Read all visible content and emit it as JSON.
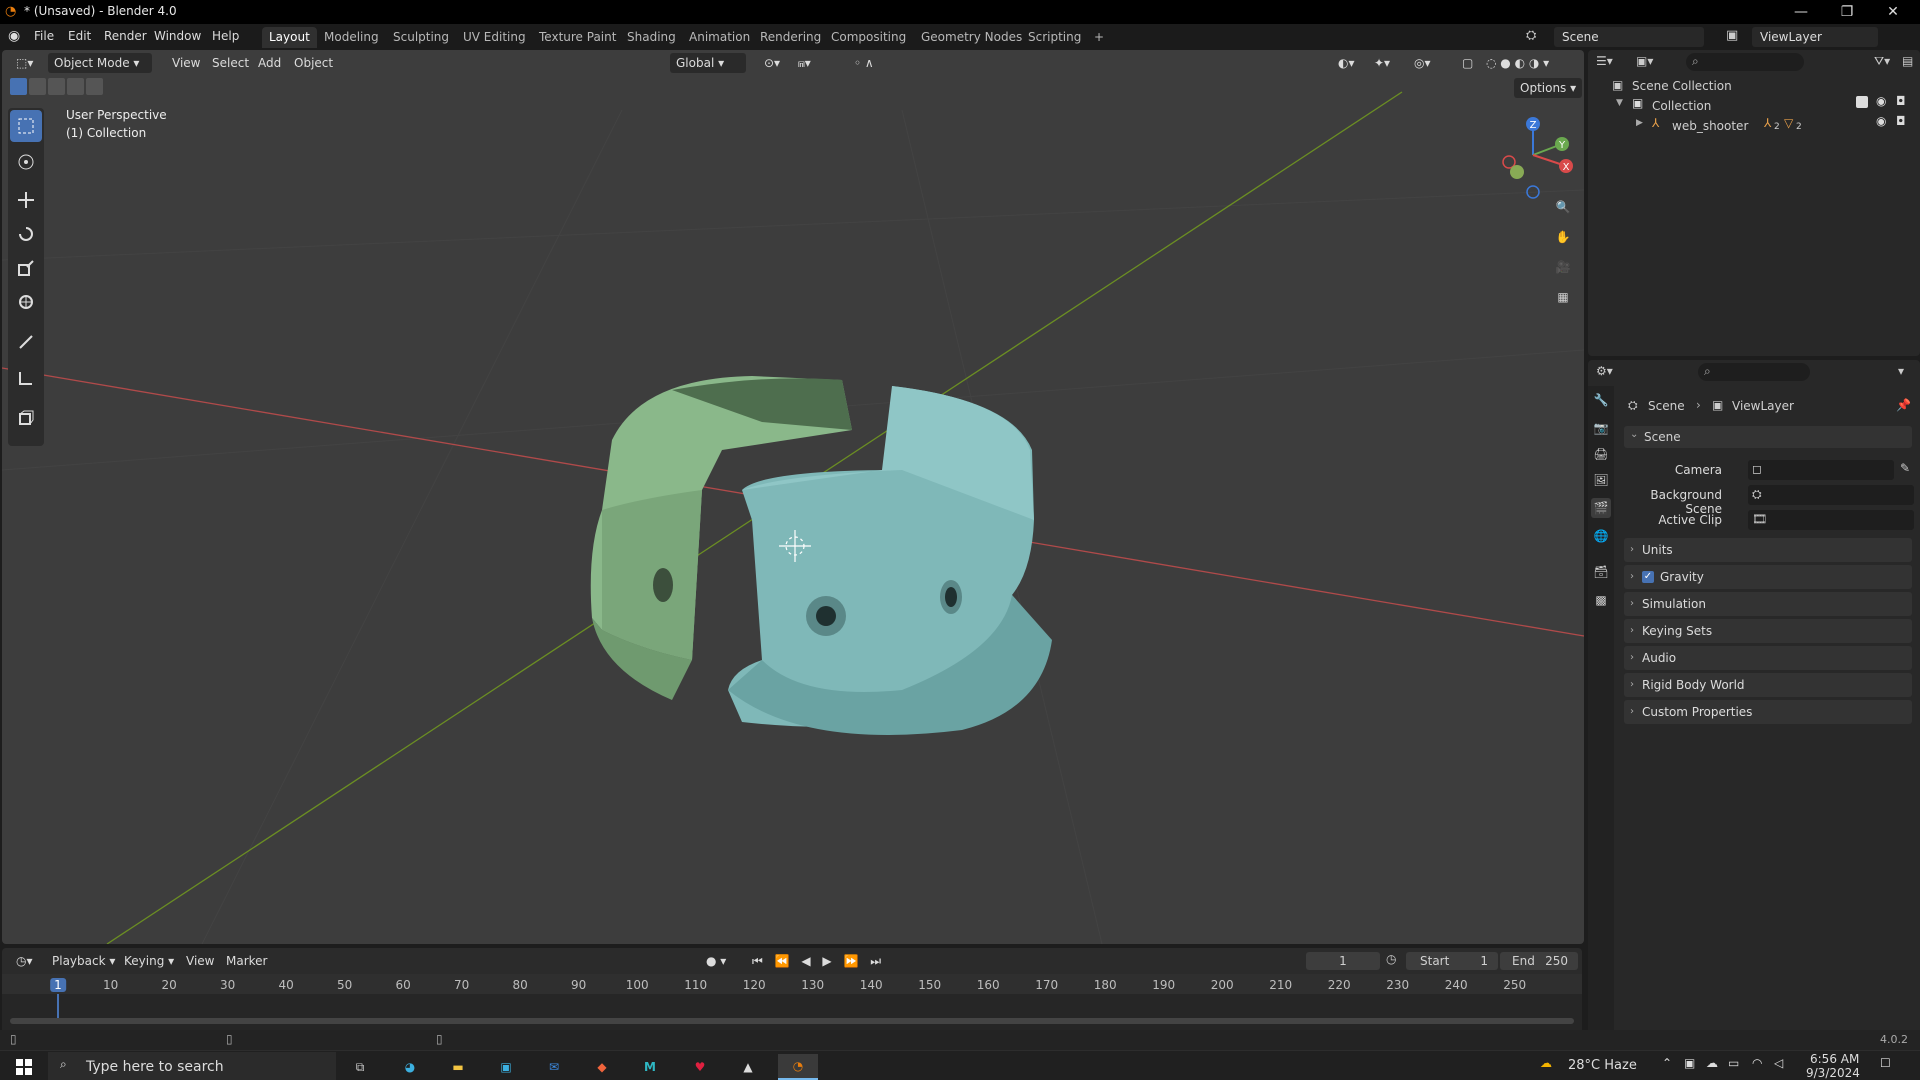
{
  "window": {
    "title": "* (Unsaved) - Blender 4.0",
    "min": "—",
    "max": "❐",
    "close": "✕"
  },
  "menu": [
    "File",
    "Edit",
    "Render",
    "Window",
    "Help"
  ],
  "workspaces": [
    "Layout",
    "Modeling",
    "Sculpting",
    "UV Editing",
    "Texture Paint",
    "Shading",
    "Animation",
    "Rendering",
    "Compositing",
    "Geometry Nodes",
    "Scripting",
    "+"
  ],
  "scene_selector": "Scene",
  "viewlayer_selector": "ViewLayer",
  "viewport": {
    "mode": "Object Mode",
    "menus": [
      "View",
      "Select",
      "Add",
      "Object"
    ],
    "transform": "Global",
    "options": "Options",
    "overlay_title": "User Perspective",
    "overlay_subtitle": "(1) Collection",
    "gizmo": {
      "z": "Z",
      "y": "Y",
      "x": "X"
    }
  },
  "outliner": {
    "root": "Scene Collection",
    "collection": "Collection",
    "object": "web_shooter",
    "object_badge1": "2",
    "object_badge2": "2"
  },
  "properties": {
    "breadcrumb": [
      "Scene",
      "ViewLayer"
    ],
    "section": "Scene",
    "fields": [
      {
        "label": "Camera",
        "value": ""
      },
      {
        "label": "Background Scene",
        "value": ""
      },
      {
        "label": "Active Clip",
        "value": ""
      }
    ],
    "panels": [
      {
        "label": "Units",
        "checkbox": false
      },
      {
        "label": "Gravity",
        "checkbox": true
      },
      {
        "label": "Simulation",
        "checkbox": false
      },
      {
        "label": "Keying Sets",
        "checkbox": false
      },
      {
        "label": "Audio",
        "checkbox": false
      },
      {
        "label": "Rigid Body World",
        "checkbox": false
      },
      {
        "label": "Custom Properties",
        "checkbox": false
      }
    ]
  },
  "timeline": {
    "menus": [
      "Playback",
      "Keying",
      "View",
      "Marker"
    ],
    "current_frame": "1",
    "start_label": "Start",
    "start": "1",
    "end_label": "End",
    "end": "250",
    "ruler": [
      "1",
      "10",
      "20",
      "30",
      "40",
      "50",
      "60",
      "70",
      "80",
      "90",
      "100",
      "110",
      "120",
      "130",
      "140",
      "150",
      "160",
      "170",
      "180",
      "190",
      "200",
      "210",
      "220",
      "230",
      "240",
      "250"
    ]
  },
  "version": "4.0.2",
  "taskbar": {
    "search_placeholder": "Type here to search",
    "weather": "28°C  Haze",
    "time": "6:56 AM",
    "date": "9/3/2024"
  },
  "colors": {
    "accent": "#4772b3",
    "green_part": "#8ab88a",
    "teal_part": "#7fb8b8"
  }
}
